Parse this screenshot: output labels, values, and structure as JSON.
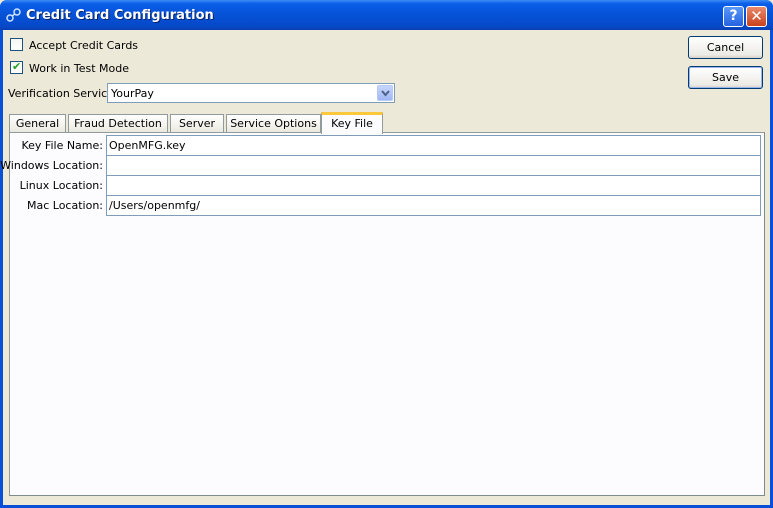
{
  "window": {
    "title": "Credit Card Configuration",
    "help_label": "?",
    "close_label": "✕"
  },
  "options": {
    "accept_credit_cards": {
      "label": "Accept Credit Cards",
      "checked": false
    },
    "work_in_test_mode": {
      "label": "Work in Test Mode",
      "checked": true
    }
  },
  "verification": {
    "label": "Verification Service:",
    "value": "YourPay"
  },
  "buttons": {
    "cancel": "Cancel",
    "save": "Save"
  },
  "tabs": [
    {
      "label": "General",
      "active": false
    },
    {
      "label": "Fraud Detection",
      "active": false
    },
    {
      "label": "Server",
      "active": false
    },
    {
      "label": "Service Options",
      "active": false
    },
    {
      "label": "Key File",
      "active": true
    }
  ],
  "key_file": {
    "fields": [
      {
        "label": "Key File Name:",
        "value": "OpenMFG.key"
      },
      {
        "label": "Windows Location:",
        "value": ""
      },
      {
        "label": "Linux Location:",
        "value": ""
      },
      {
        "label": "Mac Location:",
        "value": "/Users/openmfg/"
      }
    ]
  },
  "colors": {
    "titlebar": "#0652d6",
    "dialog_bg": "#ece9d8",
    "active_tab_accent": "#ffc83c",
    "check_mark": "#21a121"
  }
}
